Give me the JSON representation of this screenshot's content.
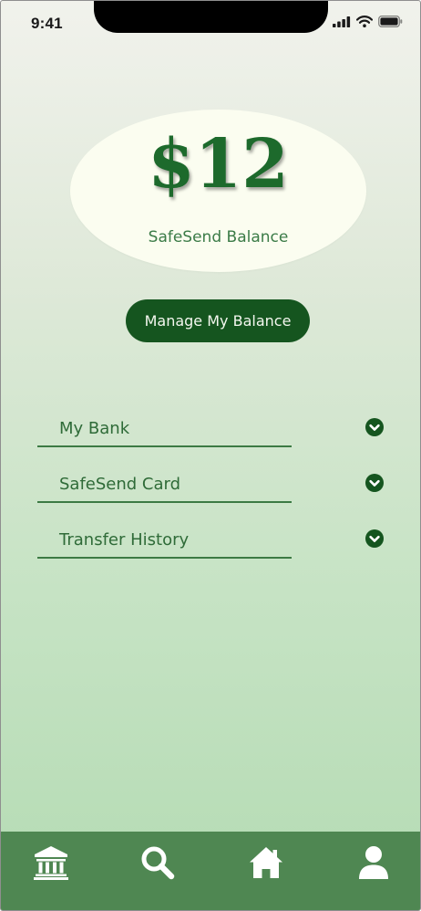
{
  "status_bar": {
    "time": "9:41",
    "icons": [
      "signal-icon",
      "wifi-icon",
      "battery-icon"
    ]
  },
  "balance": {
    "amount": "$12",
    "label": "SafeSend Balance"
  },
  "manage_button": {
    "label": "Manage My Balance"
  },
  "menu": {
    "items": [
      {
        "label": "My Bank",
        "icon": "chevron-down-icon"
      },
      {
        "label": "SafeSend Card",
        "icon": "chevron-down-icon"
      },
      {
        "label": "Transfer History",
        "icon": "chevron-down-icon"
      }
    ]
  },
  "bottom_nav": {
    "items": [
      {
        "icon": "bank-icon"
      },
      {
        "icon": "search-icon"
      },
      {
        "icon": "home-icon"
      },
      {
        "icon": "profile-icon"
      }
    ]
  },
  "colors": {
    "primary_dark": "#15551f",
    "accent_green": "#1d6a2c",
    "nav_background": "#4f8752",
    "ellipse_fill": "#fbfdf0"
  }
}
